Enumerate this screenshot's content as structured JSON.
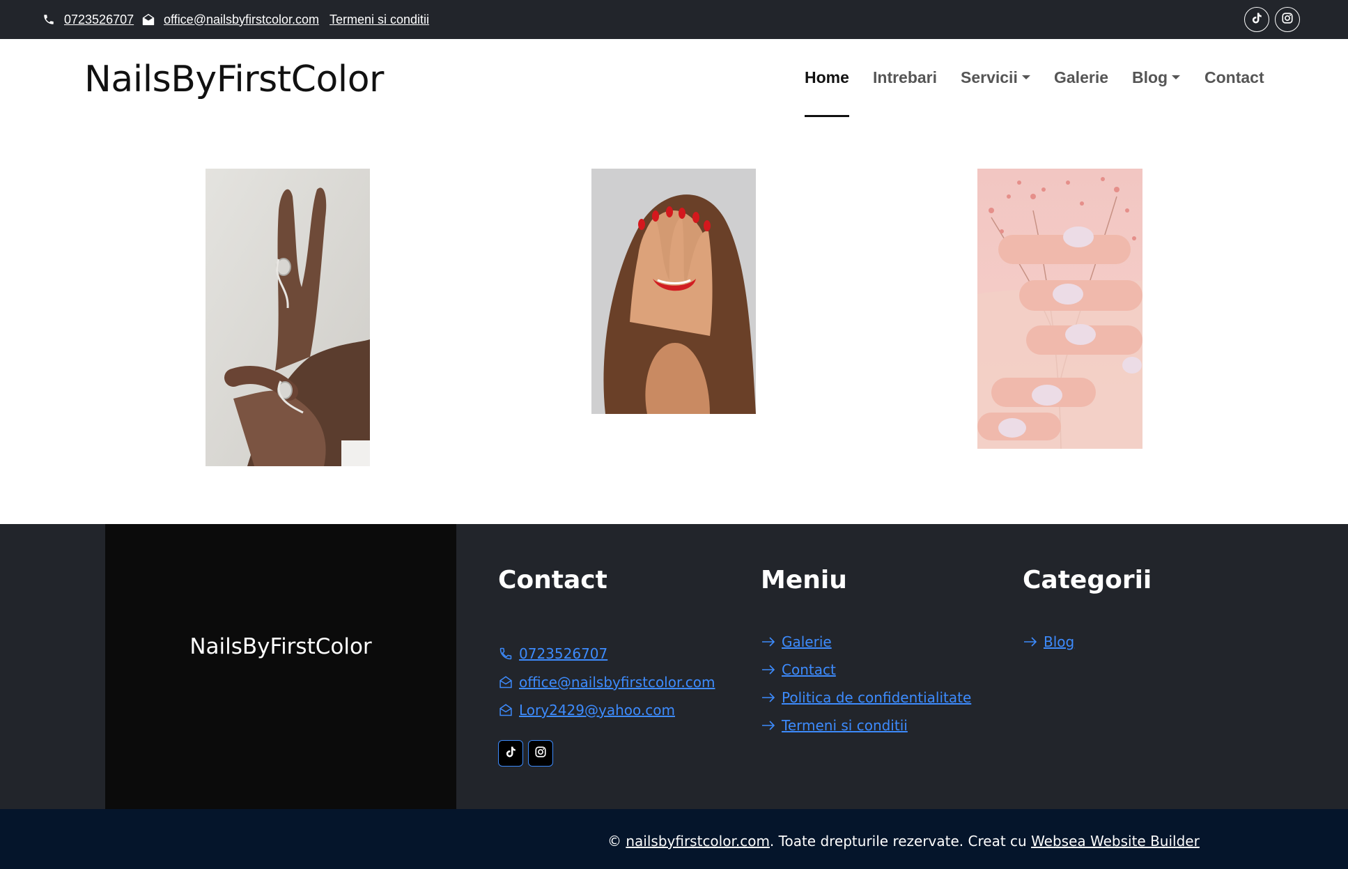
{
  "topbar": {
    "phone": "0723526707",
    "email": "office@nailsbyfirstcolor.com",
    "terms": "Termeni si conditii"
  },
  "header": {
    "logo": "NailsByFirstColor",
    "nav": [
      {
        "label": "Home",
        "active": true
      },
      {
        "label": "Intrebari"
      },
      {
        "label": "Servicii",
        "dropdown": true
      },
      {
        "label": "Galerie"
      },
      {
        "label": "Blog",
        "dropdown": true
      },
      {
        "label": "Contact"
      }
    ]
  },
  "footer": {
    "brand": "NailsByFirstColor",
    "contact": {
      "title": "Contact",
      "phone": "0723526707",
      "email1": "office@nailsbyfirstcolor.com",
      "email2": "Lory2429@yahoo.com"
    },
    "menu": {
      "title": "Meniu",
      "items": [
        "Galerie",
        "Contact",
        "Politica de confidentialitate",
        "Termeni si conditii"
      ]
    },
    "categories": {
      "title": "Categorii",
      "items": [
        "Blog"
      ]
    },
    "copyright": {
      "prefix": "© ",
      "site": "nailsbyfirstcolor.com",
      "middle": ". Toate drepturile rezervate. Creat cu ",
      "builder": "Websea Website Builder"
    }
  },
  "colors": {
    "topbar": "#22252b",
    "footer": "#22252b",
    "footer_brand": "#0b0b0b",
    "bottombar": "#05152b",
    "link": "#3d8bfd"
  }
}
